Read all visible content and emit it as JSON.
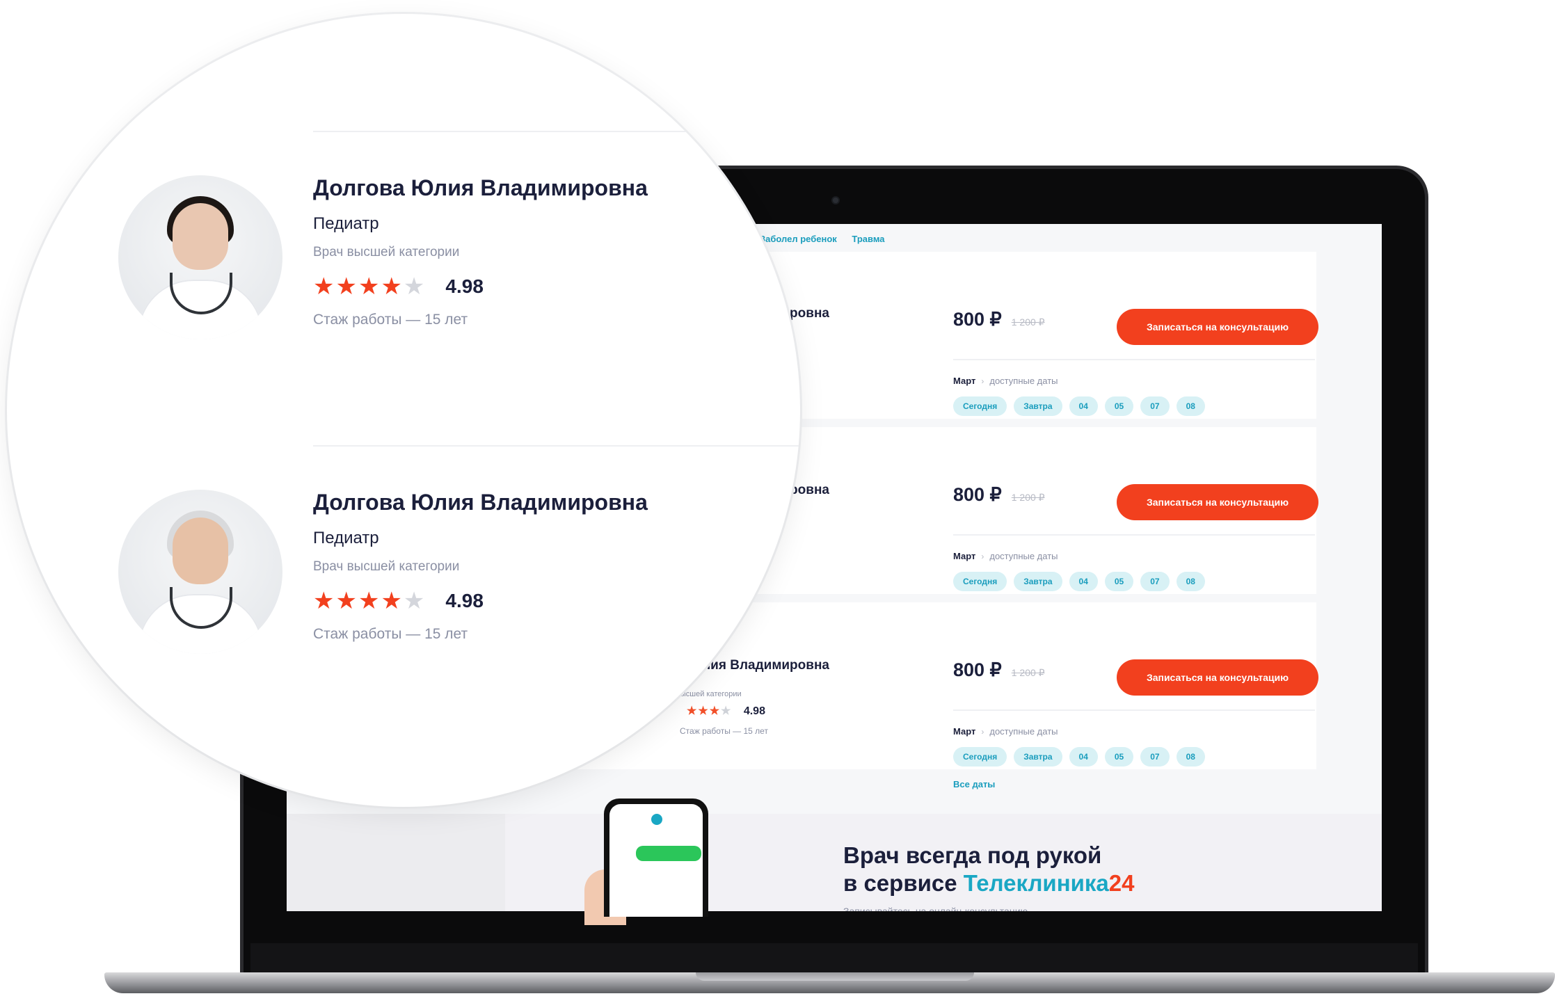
{
  "tabs": [
    "Заболел ребенок",
    "Травма"
  ],
  "doctors": [
    {
      "name": "Долгова Юлия Владимировна",
      "name_partial": "Владимировна",
      "specialty": "Педиатр",
      "category": "Врач высшей категории",
      "rating": "4.98",
      "rating_stars": 4,
      "experience": "Стаж работы — 15 лет"
    },
    {
      "name": "Долгова Юлия Владимировна",
      "name_partial": "димировна",
      "specialty": "Педиатр",
      "category": "Врач высшей категории",
      "rating": "4.98",
      "rating_stars": 4,
      "experience": "Стаж работы — 15 лет"
    },
    {
      "name": "Долгова Юлия Владимировна",
      "name_partial": "Юлия Владимировна",
      "specialty": "Педиатр",
      "category": "высшей категории",
      "rating": "4.98",
      "rating_stars": 4,
      "experience": "Стаж работы — 15 лет"
    }
  ],
  "offer": {
    "price": "800 ₽",
    "old_price": "1 200 ₽",
    "cta": "Записаться на консультацию",
    "month": "Март",
    "available_dates_label": "доступные даты",
    "dates": [
      "Сегодня",
      "Завтра",
      "04",
      "05",
      "07",
      "08"
    ],
    "all_dates": "Все даты"
  },
  "promo": {
    "title_line1": "Врач всегда под рукой",
    "title_line2_prefix": "в сервисе ",
    "brand_a": "Телеклиника",
    "brand_b": "24",
    "subtitle": "Записывайтесь на онлайн-консультацию"
  },
  "colors": {
    "accent": "#f2401e",
    "teal": "#1a9dbd",
    "chip_bg": "#d8f1f5",
    "text_dark": "#1b1f3b",
    "text_muted": "#8a8fa3"
  },
  "icons": {
    "star": "star-icon",
    "chevron": "chevron-right-icon"
  }
}
